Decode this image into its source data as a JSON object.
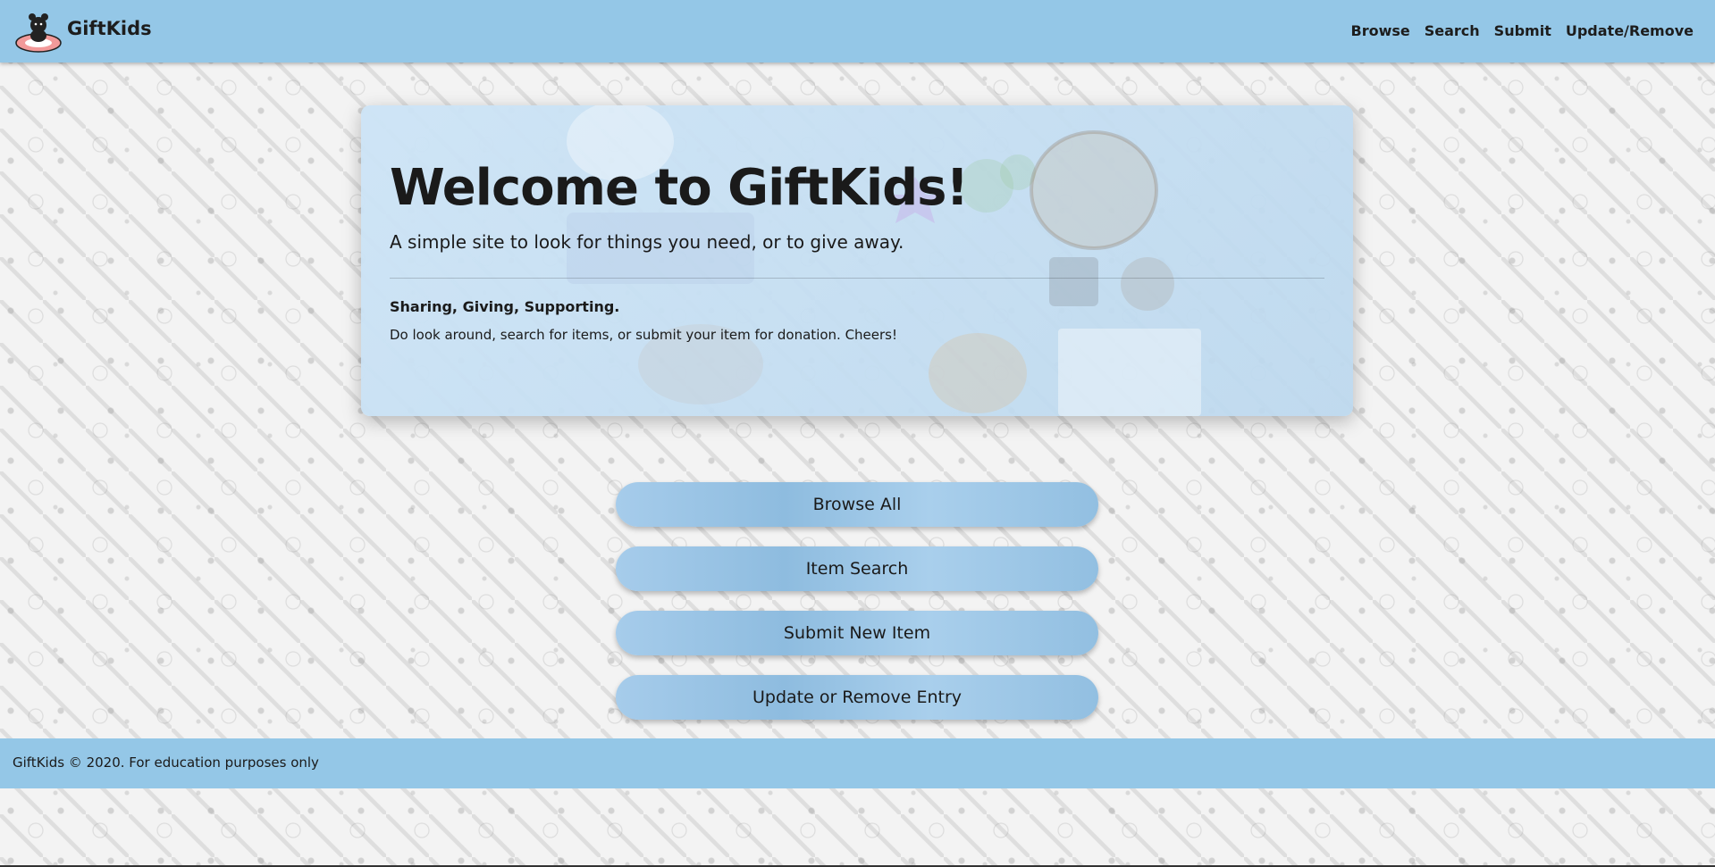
{
  "navbar": {
    "brand": "GiftKids",
    "links": [
      "Browse",
      "Search",
      "Submit",
      "Update/Remove"
    ],
    "logo_icon": "teddy-bear-logo-icon"
  },
  "hero": {
    "title": "Welcome to GiftKids!",
    "subtitle": "A simple site to look for things you need, or to give away.",
    "tagline": "Sharing, Giving, Supporting.",
    "text": "Do look around, search for items, or submit your item for donation. Cheers!"
  },
  "actions": {
    "browse_all": "Browse All",
    "item_search": "Item Search",
    "submit_new": "Submit New Item",
    "update_remove": "Update or Remove Entry"
  },
  "footer": {
    "text": "GiftKids © 2020. For education purposes only"
  },
  "colors": {
    "accent": "#94c7e7",
    "hero_bg": "#c8e1f4",
    "text": "#1a1a1a"
  }
}
